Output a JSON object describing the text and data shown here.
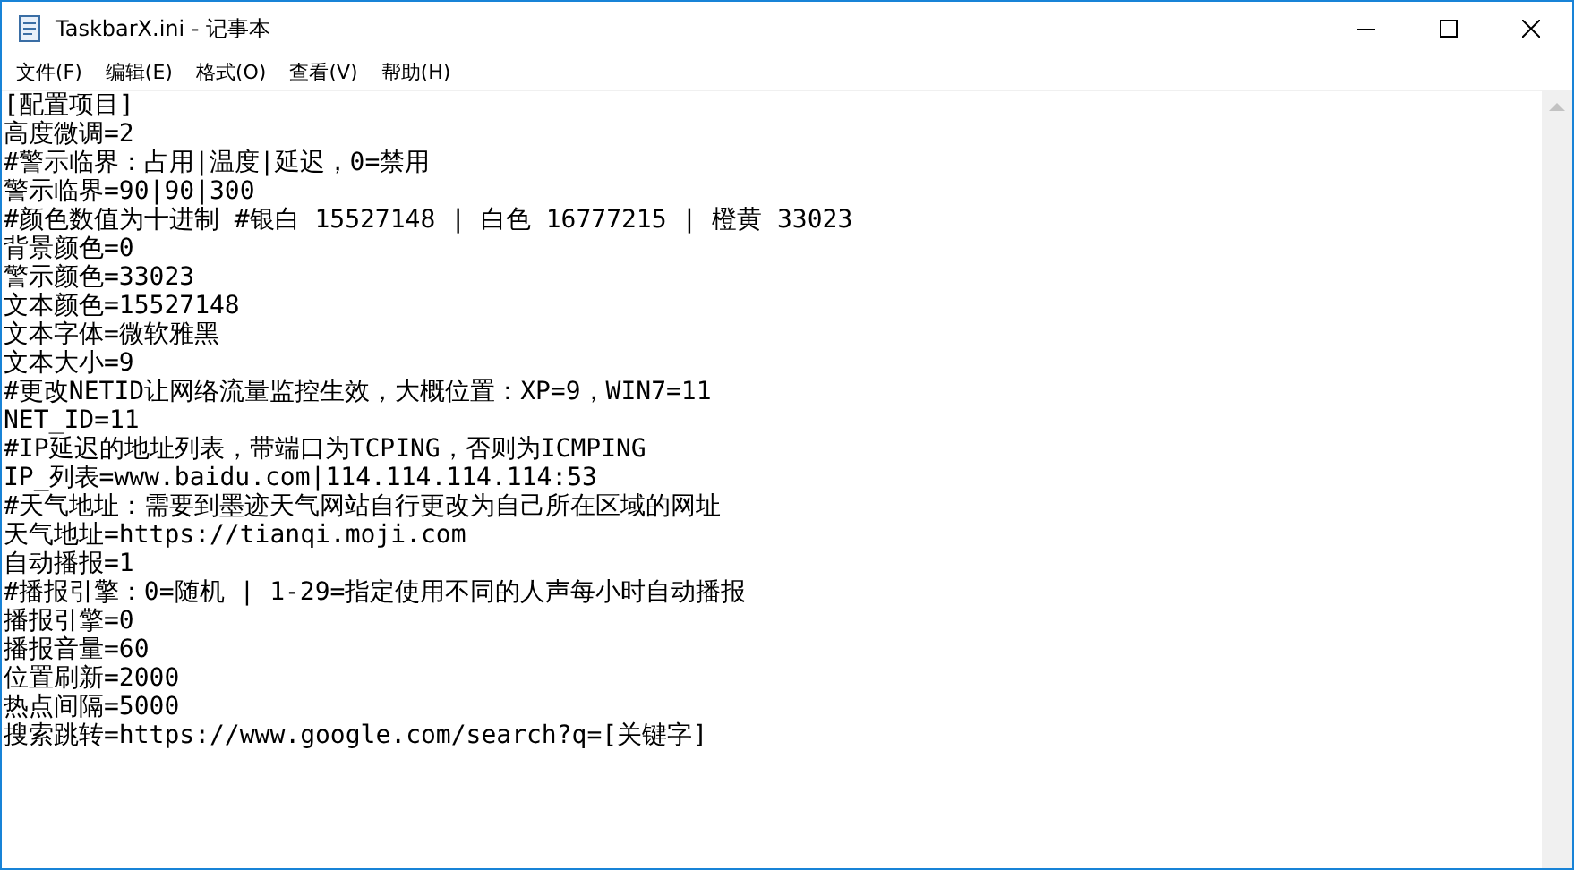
{
  "window": {
    "title": "TaskbarX.ini - 记事本"
  },
  "menu": [
    "文件(F)",
    "编辑(E)",
    "格式(O)",
    "查看(V)",
    "帮助(H)"
  ],
  "editor": {
    "lines": [
      "[配置项目]",
      "高度微调=2",
      "#警示临界：占用|温度|延迟，0=禁用",
      "警示临界=90|90|300",
      "#颜色数值为十进制 #银白 15527148 | 白色 16777215 | 橙黄 33023",
      "背景颜色=0",
      "警示颜色=33023",
      "文本颜色=15527148",
      "文本字体=微软雅黑",
      "文本大小=9",
      "#更改NETID让网络流量监控生效，大概位置：XP=9，WIN7=11",
      "NET_ID=11",
      "#IP延迟的地址列表，带端口为TCPING，否则为ICMPING",
      "IP_列表=www.baidu.com|114.114.114.114:53",
      "#天气地址：需要到墨迹天气网站自行更改为自己所在区域的网址",
      "天气地址=https://tianqi.moji.com",
      "自动播报=1",
      "#播报引擎：0=随机 | 1-29=指定使用不同的人声每小时自动播报",
      "播报引擎=0",
      "播报音量=60",
      "位置刷新=2000",
      "热点间隔=5000",
      "搜索跳转=https://www.google.com/search?q=[关键字]"
    ]
  }
}
